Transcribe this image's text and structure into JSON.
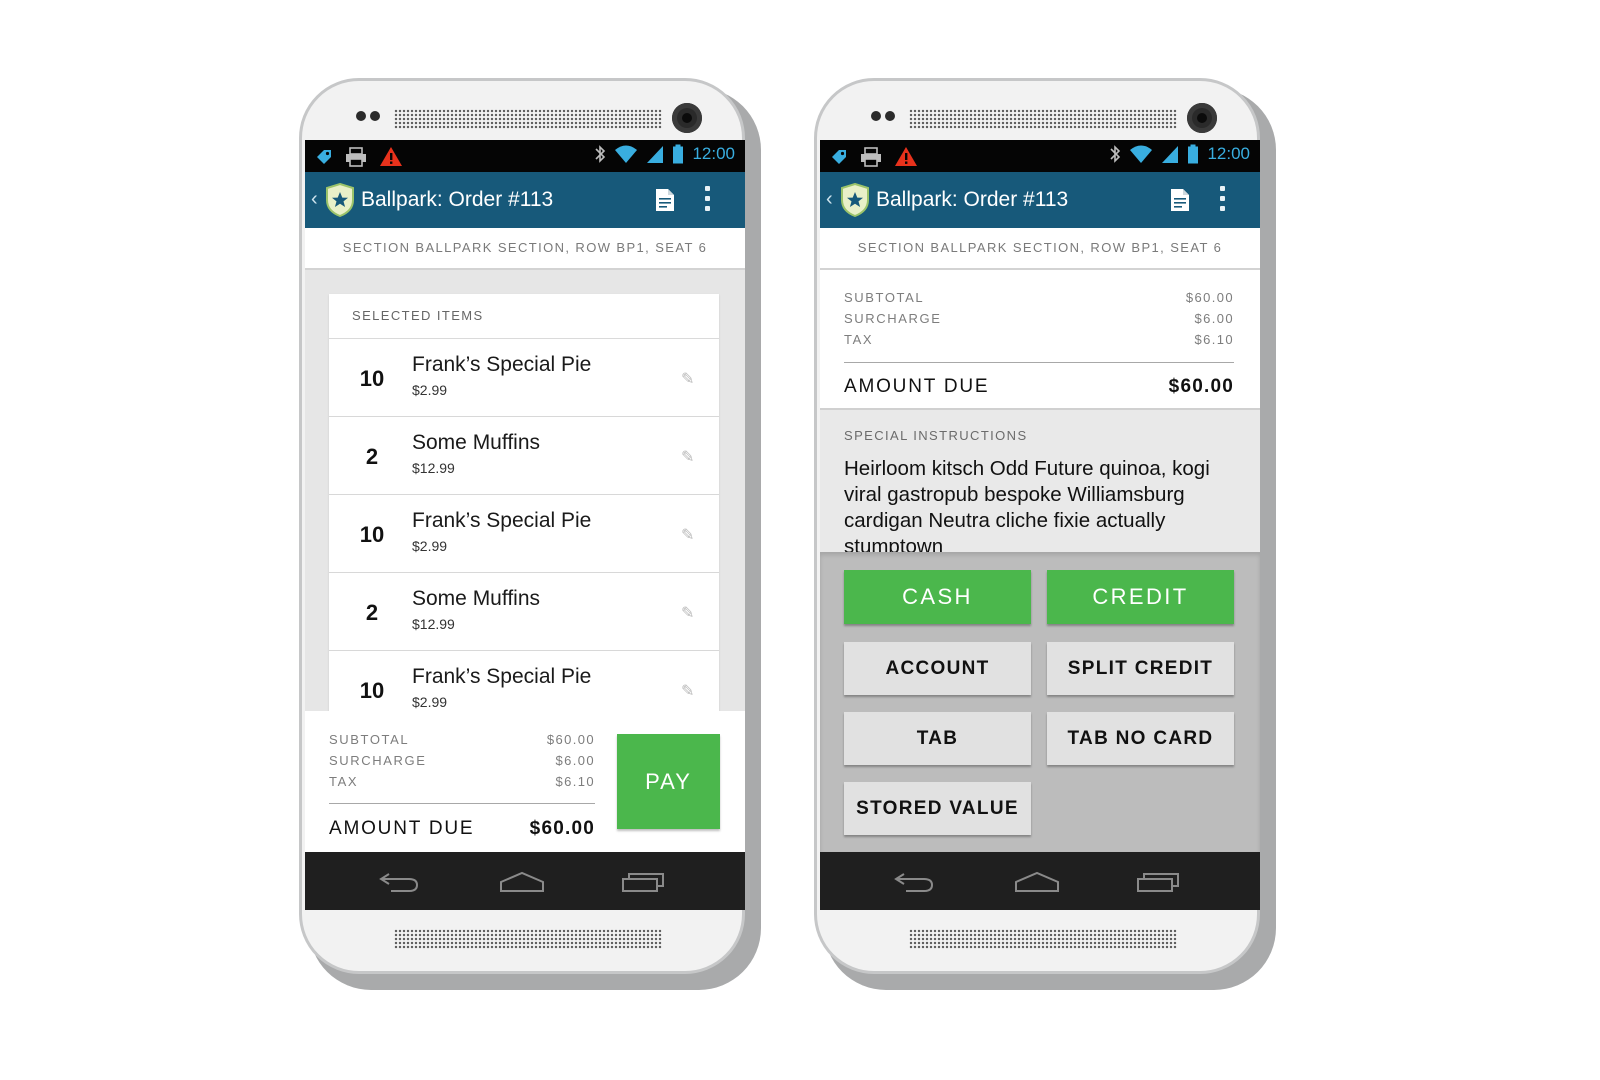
{
  "status_bar": {
    "time": "12:00"
  },
  "app_bar": {
    "back": "‹",
    "title": "Ballpark: Order #113"
  },
  "location": "SECTION BALLPARK SECTION, ROW BP1, SEAT 6",
  "order_screen": {
    "items_header": "SELECTED ITEMS",
    "items": [
      {
        "qty": "10",
        "name": "Frank’s Special Pie",
        "price": "$2.99"
      },
      {
        "qty": "2",
        "name": "Some Muffins",
        "price": "$12.99"
      },
      {
        "qty": "10",
        "name": "Frank’s Special Pie",
        "price": "$2.99"
      },
      {
        "qty": "2",
        "name": "Some Muffins",
        "price": "$12.99"
      },
      {
        "qty": "10",
        "name": "Frank’s Special Pie",
        "price": "$2.99"
      }
    ],
    "pay_label": "PAY"
  },
  "totals": {
    "subtotal_label": "SUBTOTAL",
    "subtotal": "$60.00",
    "surcharge_label": "SURCHARGE",
    "surcharge": "$6.00",
    "tax_label": "TAX",
    "tax": "$6.10",
    "amount_due_label": "AMOUNT DUE",
    "amount_due": "$60.00"
  },
  "payment_screen": {
    "instructions_label": "SPECIAL INSTRUCTIONS",
    "instructions_text": "Heirloom kitsch Odd Future quinoa, kogi viral gastropub bespoke Williamsburg cardigan Neutra cliche fixie actually stumptown",
    "buttons": {
      "cash": "CASH",
      "credit": "CREDIT",
      "account": "ACCOUNT",
      "split_credit": "SPLIT CREDIT",
      "tab": "TAB",
      "tab_no_card": "TAB NO CARD",
      "stored_value": "STORED VALUE"
    }
  },
  "colors": {
    "app_bar": "#17597a",
    "status_icon": "#39aee0",
    "accent_green": "#4bb74c",
    "alert_red": "#e8321c"
  },
  "icons": [
    "tag-icon",
    "printer-icon",
    "warning-icon",
    "bluetooth-icon",
    "wifi-icon",
    "signal-icon",
    "battery-icon",
    "shield-logo-icon",
    "document-icon",
    "overflow-menu-icon",
    "pencil-icon",
    "nav-back-icon",
    "nav-home-icon",
    "nav-recents-icon"
  ]
}
